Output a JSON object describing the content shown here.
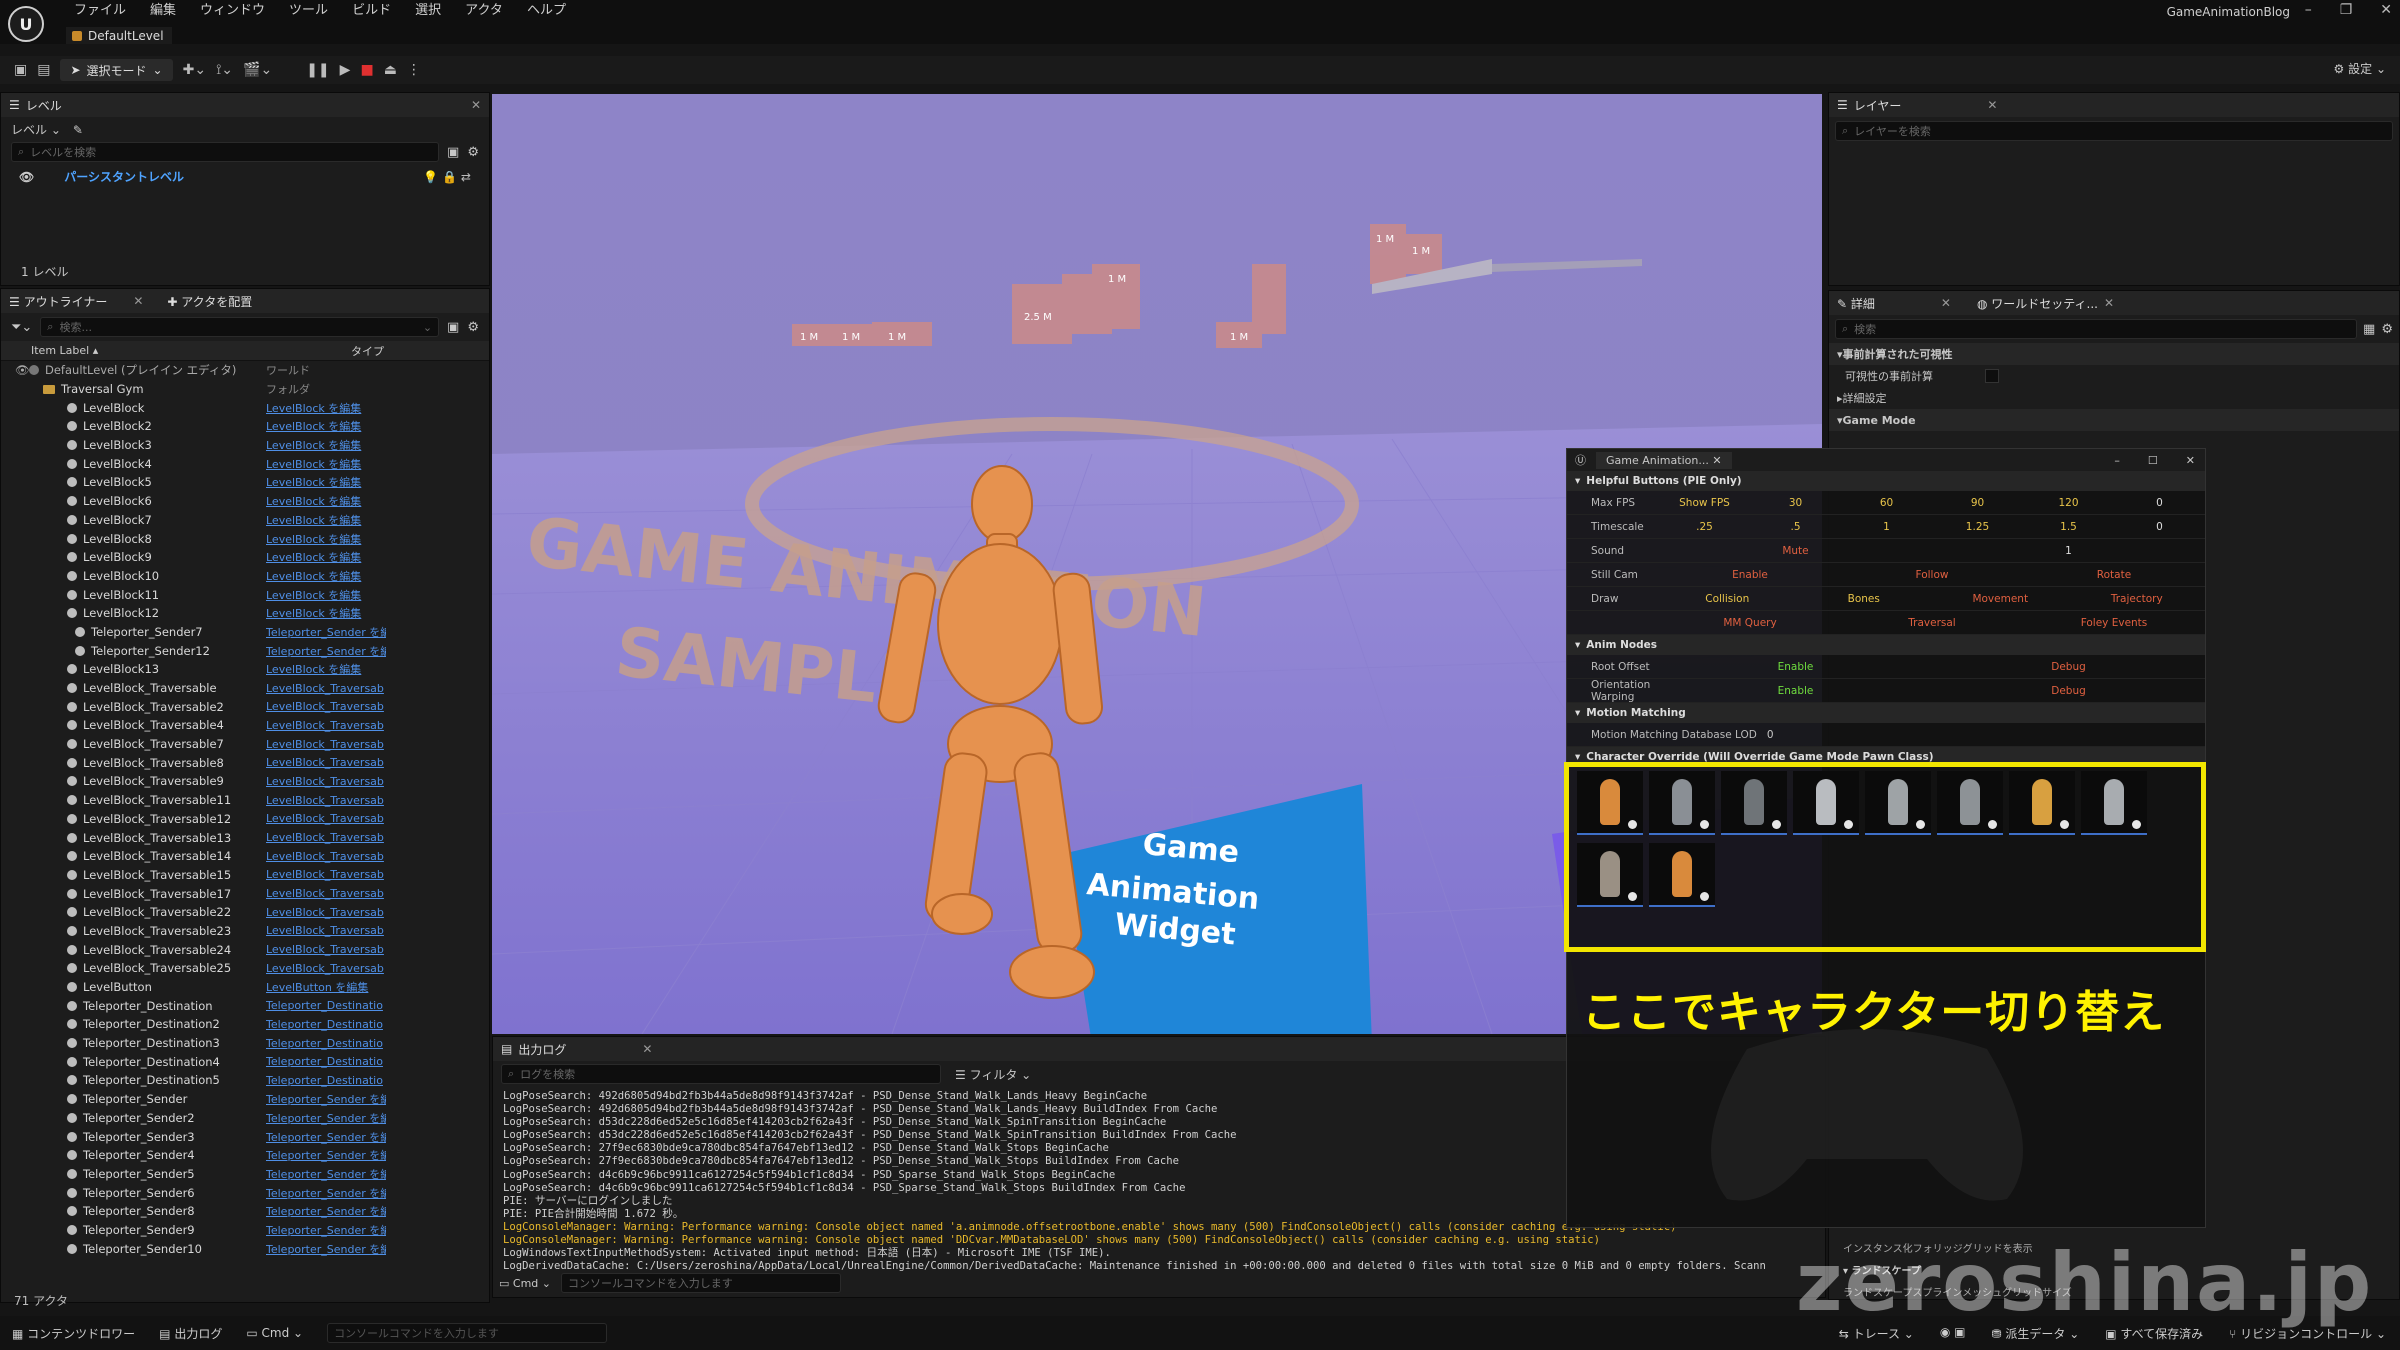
{
  "menu": [
    "ファイル",
    "編集",
    "ウィンドウ",
    "ツール",
    "ビルド",
    "選択",
    "アクタ",
    "ヘルプ"
  ],
  "level_tab": "DefaultLevel",
  "project_name": "GameAnimationBlog",
  "toolbar": {
    "mode": "選択モード",
    "settings": "設定"
  },
  "levels": {
    "tab": "レベル",
    "dropdown": "レベル",
    "search_placeholder": "レベルを検索",
    "persistent": "パーシスタントレベル",
    "count": "1 レベル"
  },
  "outliner": {
    "tab": "アウトライナー",
    "tab2": "アクタを配置",
    "search_placeholder": "検索...",
    "col_label": "Item Label",
    "col_type": "タイプ",
    "rows": [
      {
        "name": "DefaultLevel (プレイイン エディタ)",
        "type": "ワールド",
        "kind": "world"
      },
      {
        "name": "Traversal Gym",
        "type": "フォルダ",
        "kind": "folder"
      },
      {
        "name": "LevelBlock",
        "type": "LevelBlock を編集"
      },
      {
        "name": "LevelBlock2",
        "type": "LevelBlock を編集"
      },
      {
        "name": "LevelBlock3",
        "type": "LevelBlock を編集"
      },
      {
        "name": "LevelBlock4",
        "type": "LevelBlock を編集"
      },
      {
        "name": "LevelBlock5",
        "type": "LevelBlock を編集"
      },
      {
        "name": "LevelBlock6",
        "type": "LevelBlock を編集"
      },
      {
        "name": "LevelBlock7",
        "type": "LevelBlock を編集"
      },
      {
        "name": "LevelBlock8",
        "type": "LevelBlock を編集"
      },
      {
        "name": "LevelBlock9",
        "type": "LevelBlock を編集"
      },
      {
        "name": "LevelBlock10",
        "type": "LevelBlock を編集"
      },
      {
        "name": "LevelBlock11",
        "type": "LevelBlock を編集"
      },
      {
        "name": "LevelBlock12",
        "type": "LevelBlock を編集"
      },
      {
        "name": "Teleporter_Sender7",
        "type": "Teleporter_Sender を編",
        "indent": 2
      },
      {
        "name": "Teleporter_Sender12",
        "type": "Teleporter_Sender を編",
        "indent": 2
      },
      {
        "name": "LevelBlock13",
        "type": "LevelBlock を編集"
      },
      {
        "name": "LevelBlock_Traversable",
        "type": "LevelBlock_Traversab"
      },
      {
        "name": "LevelBlock_Traversable2",
        "type": "LevelBlock_Traversab"
      },
      {
        "name": "LevelBlock_Traversable4",
        "type": "LevelBlock_Traversab"
      },
      {
        "name": "LevelBlock_Traversable7",
        "type": "LevelBlock_Traversab"
      },
      {
        "name": "LevelBlock_Traversable8",
        "type": "LevelBlock_Traversab"
      },
      {
        "name": "LevelBlock_Traversable9",
        "type": "LevelBlock_Traversab"
      },
      {
        "name": "LevelBlock_Traversable11",
        "type": "LevelBlock_Traversab"
      },
      {
        "name": "LevelBlock_Traversable12",
        "type": "LevelBlock_Traversab"
      },
      {
        "name": "LevelBlock_Traversable13",
        "type": "LevelBlock_Traversab"
      },
      {
        "name": "LevelBlock_Traversable14",
        "type": "LevelBlock_Traversab"
      },
      {
        "name": "LevelBlock_Traversable15",
        "type": "LevelBlock_Traversab"
      },
      {
        "name": "LevelBlock_Traversable17",
        "type": "LevelBlock_Traversab"
      },
      {
        "name": "LevelBlock_Traversable22",
        "type": "LevelBlock_Traversab"
      },
      {
        "name": "LevelBlock_Traversable23",
        "type": "LevelBlock_Traversab"
      },
      {
        "name": "LevelBlock_Traversable24",
        "type": "LevelBlock_Traversab"
      },
      {
        "name": "LevelBlock_Traversable25",
        "type": "LevelBlock_Traversab"
      },
      {
        "name": "LevelButton",
        "type": "LevelButton を編集"
      },
      {
        "name": "Teleporter_Destination",
        "type": "Teleporter_Destinatio"
      },
      {
        "name": "Teleporter_Destination2",
        "type": "Teleporter_Destinatio"
      },
      {
        "name": "Teleporter_Destination3",
        "type": "Teleporter_Destinatio"
      },
      {
        "name": "Teleporter_Destination4",
        "type": "Teleporter_Destinatio"
      },
      {
        "name": "Teleporter_Destination5",
        "type": "Teleporter_Destinatio"
      },
      {
        "name": "Teleporter_Sender",
        "type": "Teleporter_Sender を編"
      },
      {
        "name": "Teleporter_Sender2",
        "type": "Teleporter_Sender を編"
      },
      {
        "name": "Teleporter_Sender3",
        "type": "Teleporter_Sender を編"
      },
      {
        "name": "Teleporter_Sender4",
        "type": "Teleporter_Sender を編"
      },
      {
        "name": "Teleporter_Sender5",
        "type": "Teleporter_Sender を編"
      },
      {
        "name": "Teleporter_Sender6",
        "type": "Teleporter_Sender を編"
      },
      {
        "name": "Teleporter_Sender8",
        "type": "Teleporter_Sender を編"
      },
      {
        "name": "Teleporter_Sender9",
        "type": "Teleporter_Sender を編"
      },
      {
        "name": "Teleporter_Sender10",
        "type": "Teleporter_Sender を編"
      }
    ],
    "actor_count": "71 アクタ"
  },
  "layers": {
    "tab": "レイヤー",
    "search_placeholder": "レイヤーを検索"
  },
  "details": {
    "tab": "詳細",
    "tab2": "ワールドセッティ...",
    "search_placeholder": "検索",
    "sections": [
      "事前計算された可視性",
      "可視性の事前計算",
      "詳細設定",
      "Game Mode"
    ],
    "bottom_items": [
      "インスタンス化フォリッジグリッドを表示",
      "ランドスケープ",
      "ランドスケープスプラインメッシュグリッドサイズ"
    ]
  },
  "viewport": {
    "sign_lines": [
      "Game",
      "Animation",
      "Widget"
    ],
    "floor_text_1": "GAME ANIMATION",
    "floor_text_2": "SAMPLE",
    "block_labels": [
      "1 M",
      "1 M",
      "1 M",
      "2.5 M",
      "1 M",
      "1 M",
      "1 M",
      "1 M"
    ]
  },
  "widget": {
    "title": "Game Animation...",
    "helpful": "Helpful Buttons (PIE Only)",
    "rows": [
      {
        "label": "Max FPS",
        "cells": [
          {
            "t": "Show FPS",
            "c": "y"
          },
          {
            "t": "30",
            "c": "y"
          },
          {
            "t": "60",
            "c": "y"
          },
          {
            "t": "90",
            "c": "y"
          },
          {
            "t": "120",
            "c": "y"
          },
          {
            "t": "0",
            "c": "w"
          }
        ]
      },
      {
        "label": "Timescale",
        "cells": [
          {
            "t": ".25",
            "c": "y"
          },
          {
            "t": ".5",
            "c": "y"
          },
          {
            "t": "1",
            "c": "y"
          },
          {
            "t": "1.25",
            "c": "y"
          },
          {
            "t": "1.5",
            "c": "y"
          },
          {
            "t": "0",
            "c": "w"
          }
        ]
      },
      {
        "label": "Sound",
        "cells": [
          {
            "t": "Mute",
            "c": "r"
          },
          {
            "t": "1",
            "c": "w"
          }
        ]
      },
      {
        "label": "Still Cam",
        "cells": [
          {
            "t": "Enable",
            "c": "r"
          },
          {
            "t": "Follow",
            "c": "r"
          },
          {
            "t": "Rotate",
            "c": "r"
          }
        ]
      },
      {
        "label": "Draw",
        "cells": [
          {
            "t": "Collision",
            "c": "y"
          },
          {
            "t": "Bones",
            "c": "y"
          },
          {
            "t": "Movement",
            "c": "r"
          },
          {
            "t": "Trajectory",
            "c": "r"
          }
        ]
      },
      {
        "label": "",
        "cells": [
          {
            "t": "MM Query",
            "c": "r"
          },
          {
            "t": "Traversal",
            "c": "r"
          },
          {
            "t": "Foley Events",
            "c": "r"
          }
        ]
      }
    ],
    "anim_nodes": "Anim Nodes",
    "anim_rows": [
      {
        "label": "Root Offset",
        "cells": [
          {
            "t": "Enable",
            "c": "g"
          },
          {
            "t": "Debug",
            "c": "r"
          }
        ]
      },
      {
        "label": "Orientation Warping",
        "cells": [
          {
            "t": "Enable",
            "c": "g"
          },
          {
            "t": "Debug",
            "c": "r"
          }
        ]
      }
    ],
    "motion_matching": "Motion Matching",
    "mm_row": {
      "label": "Motion Matching Database LOD",
      "value": "0"
    },
    "char_override": "Character Override (Will Override Game Mode Pawn Class)",
    "thumb_colors": [
      "#d98a3c",
      "#8a8f95",
      "#6f7478",
      "#b9bcc0",
      "#9ea3a6",
      "#8d9296",
      "#d8a040",
      "#a8acb0",
      "#9a9084",
      "#d98a3c"
    ]
  },
  "caption": "ここでキャラクター切り替え",
  "output_log": {
    "tab": "出力ログ",
    "search_placeholder": "ログを検索",
    "filter": "フィルタ",
    "cmd": "Cmd",
    "cmd_placeholder": "コンソールコマンドを入力します",
    "lines": [
      {
        "t": "LogPoseSearch: 492d6805d94bd2fb3b44a5de8d98f9143f3742af - PSD_Dense_Stand_Walk_Lands_Heavy BeginCache",
        "w": false
      },
      {
        "t": "LogPoseSearch: 492d6805d94bd2fb3b44a5de8d98f9143f3742af - PSD_Dense_Stand_Walk_Lands_Heavy BuildIndex From Cache",
        "w": false
      },
      {
        "t": "LogPoseSearch: d53dc228d6ed52e5c16d85ef414203cb2f62a43f - PSD_Dense_Stand_Walk_SpinTransition BeginCache",
        "w": false
      },
      {
        "t": "LogPoseSearch: d53dc228d6ed52e5c16d85ef414203cb2f62a43f - PSD_Dense_Stand_Walk_SpinTransition BuildIndex From Cache",
        "w": false
      },
      {
        "t": "LogPoseSearch: 27f9ec6830bde9ca780dbc854fa7647ebf13ed12 - PSD_Dense_Stand_Walk_Stops BeginCache",
        "w": false
      },
      {
        "t": "LogPoseSearch: 27f9ec6830bde9ca780dbc854fa7647ebf13ed12 - PSD_Dense_Stand_Walk_Stops BuildIndex From Cache",
        "w": false
      },
      {
        "t": "LogPoseSearch: d4c6b9c96bc9911ca6127254c5f594b1cf1c8d34 - PSD_Sparse_Stand_Walk_Stops BeginCache",
        "w": false
      },
      {
        "t": "LogPoseSearch: d4c6b9c96bc9911ca6127254c5f594b1cf1c8d34 - PSD_Sparse_Stand_Walk_Stops BuildIndex From Cache",
        "w": false
      },
      {
        "t": "PIE: サーバーにログインしました",
        "w": false
      },
      {
        "t": "PIE: PIE合計開始時間 1.672 秒。",
        "w": false
      },
      {
        "t": "LogConsoleManager: Warning: Performance warning: Console object named 'a.animnode.offsetrootbone.enable' shows many (500) FindConsoleObject() calls (consider caching e.g. using static)",
        "w": true
      },
      {
        "t": "LogConsoleManager: Warning: Performance warning: Console object named 'DDCvar.MMDatabaseLOD' shows many (500) FindConsoleObject() calls (consider caching e.g. using static)",
        "w": true
      },
      {
        "t": "LogWindowsTextInputMethodSystem: Activated input method: 日本語 (日本) - Microsoft IME (TSF IME).",
        "w": false
      },
      {
        "t": "LogDerivedDataCache: C:/Users/zeroshina/AppData/Local/UnrealEngine/Common/DerivedDataCache: Maintenance finished in +00:00:00.000 and deleted 0 files with total size 0 MiB and 0 empty folders. Scann",
        "w": false
      }
    ]
  },
  "statusbar": {
    "content_drawer": "コンテンツドロワー",
    "output_log": "出力ログ",
    "cmd": "Cmd",
    "cmd_placeholder": "コンソールコマンドを入力します",
    "trace": "トレース",
    "derived": "派生データ",
    "save_all": "すべて保存済み",
    "source_control": "リビジョンコントロール"
  },
  "watermark": "zeroshina.jp"
}
